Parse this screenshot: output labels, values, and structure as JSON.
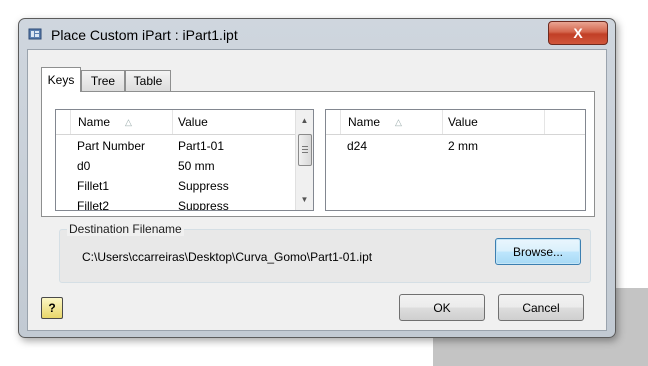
{
  "window": {
    "title": "Place Custom iPart : iPart1.ipt",
    "close_glyph": "X"
  },
  "tabs": [
    {
      "label": "Keys",
      "active": true
    },
    {
      "label": "Tree",
      "active": false
    },
    {
      "label": "Table",
      "active": false
    }
  ],
  "keys_grid": {
    "columns": [
      "Name",
      "Value"
    ],
    "rows": [
      {
        "name": "Part Number",
        "value": "Part1-01"
      },
      {
        "name": "d0",
        "value": "50 mm"
      },
      {
        "name": "Fillet1",
        "value": "Suppress"
      },
      {
        "name": "Fillet2",
        "value": "Suppress"
      }
    ]
  },
  "params_grid": {
    "columns": [
      "Name",
      "Value"
    ],
    "rows": [
      {
        "name": "d24",
        "value": "2 mm"
      }
    ]
  },
  "destination": {
    "label": "Destination Filename",
    "path": "C:\\Users\\ccarreiras\\Desktop\\Curva_Gomo\\Part1-01.ipt",
    "browse_label": "Browse..."
  },
  "buttons": {
    "ok": "OK",
    "cancel": "Cancel",
    "help_glyph": "?"
  },
  "colors": {
    "close_button": "#c13f26",
    "focus_button": "#3c7fb1"
  }
}
